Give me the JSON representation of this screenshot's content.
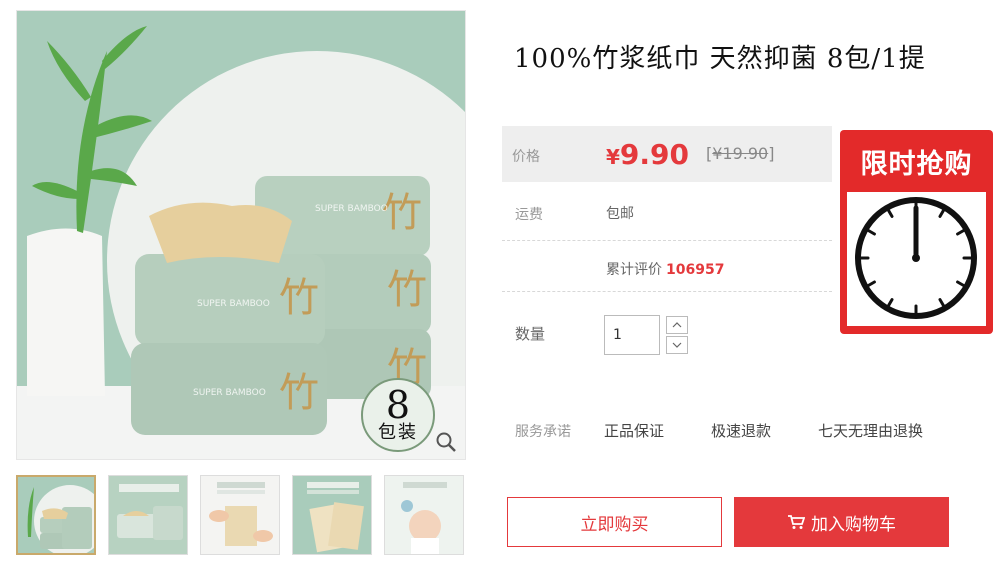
{
  "product": {
    "title": "100%竹浆纸巾 天然抑菌 8包/1提"
  },
  "image_badge": {
    "number": "8",
    "text": "包装"
  },
  "price": {
    "label": "价格",
    "currency": "¥",
    "current": "9.90",
    "original": "¥19.90"
  },
  "shipping": {
    "label": "运费",
    "value": "包邮"
  },
  "review": {
    "label": "累计评价",
    "count": "106957"
  },
  "quantity": {
    "label": "数量",
    "value": "1"
  },
  "service": {
    "label": "服务承诺",
    "items": [
      "正品保证",
      "极速退款",
      "七天无理由退换"
    ]
  },
  "buttons": {
    "buy_now": "立即购买",
    "add_to_cart": "加入购物车"
  },
  "flash_sale": {
    "text": "限时抢购"
  },
  "colors": {
    "accent_red": "#e4393c",
    "flash_red": "#e32a2a",
    "mint_bg": "#a8cbb8",
    "package_green": "#b5cdbd"
  },
  "icons": [
    "zoom-icon",
    "clock-icon",
    "cart-icon",
    "chevron-up-icon",
    "chevron-down-icon"
  ]
}
